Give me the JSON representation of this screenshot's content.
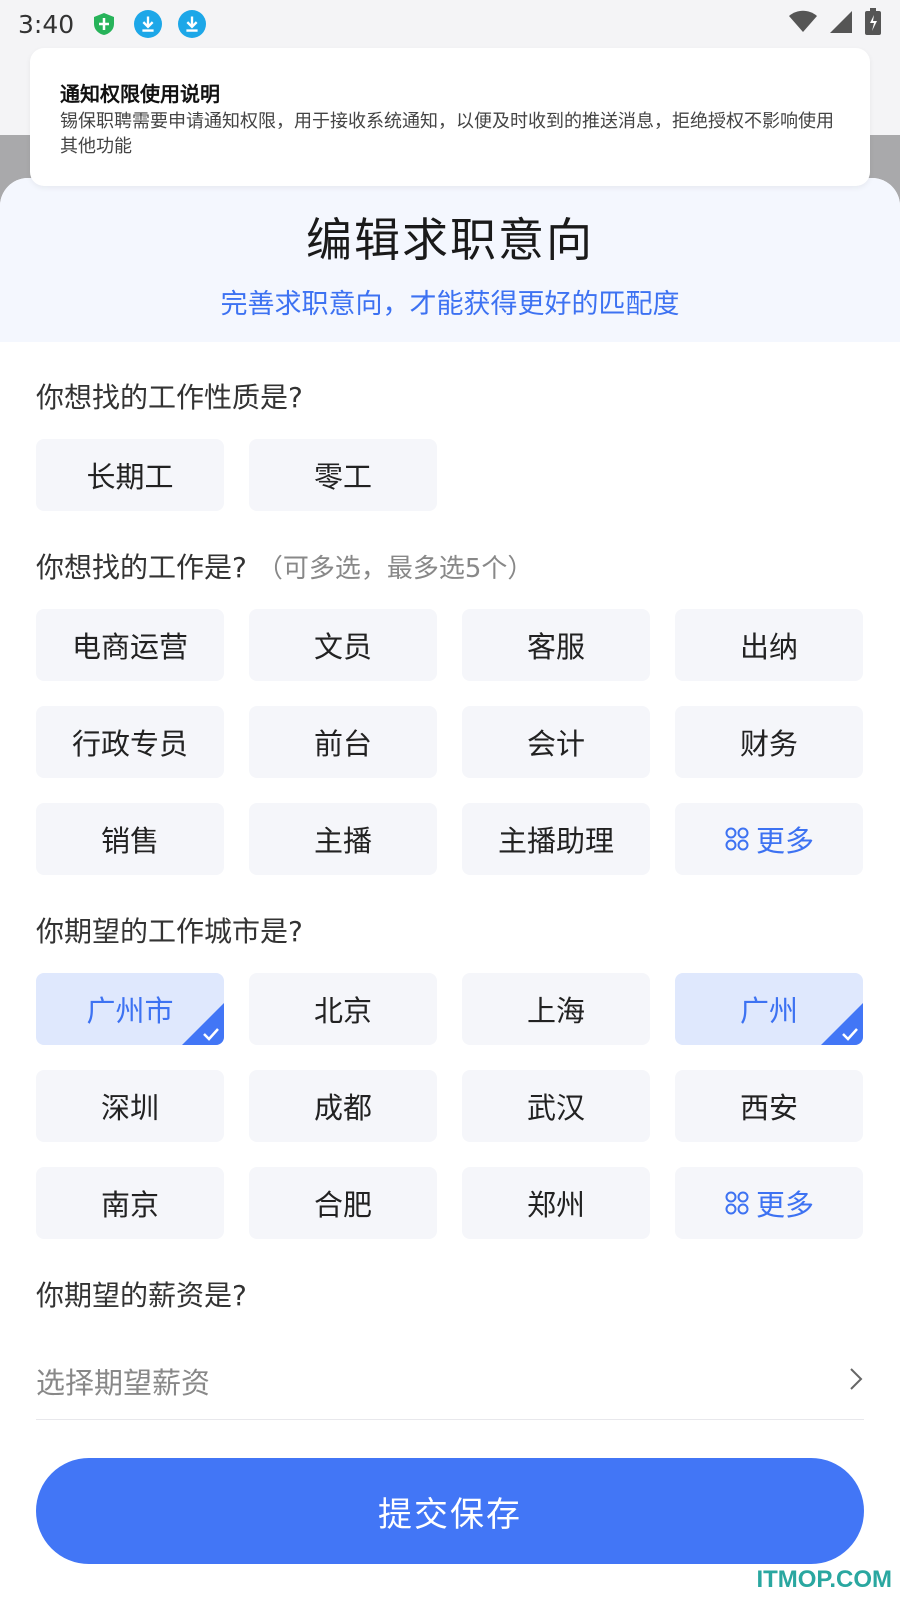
{
  "status": {
    "time": "3:40"
  },
  "notice": {
    "title": "通知权限使用说明",
    "body": "锡保职聘需要申请通知权限，用于接收系统通知，以便及时收到的推送消息，拒绝授权不影响使用其他功能"
  },
  "header": {
    "title": "编辑求职意向",
    "subtitle": "完善求职意向，才能获得更好的匹配度"
  },
  "job_type": {
    "question": "你想找的工作性质是?",
    "options": [
      "长期工",
      "零工"
    ]
  },
  "job": {
    "question": "你想找的工作是?",
    "hint": "（可多选，最多选5个）",
    "options": [
      "电商运营",
      "文员",
      "客服",
      "出纳",
      "行政专员",
      "前台",
      "会计",
      "财务",
      "销售",
      "主播",
      "主播助理"
    ],
    "more_label": "更多"
  },
  "city": {
    "question": "你期望的工作城市是?",
    "options": [
      "广州市",
      "北京",
      "上海",
      "广州",
      "深圳",
      "成都",
      "武汉",
      "西安",
      "南京",
      "合肥",
      "郑州"
    ],
    "selected": [
      "广州市",
      "广州"
    ],
    "more_label": "更多"
  },
  "salary": {
    "question": "你期望的薪资是?",
    "placeholder": "选择期望薪资"
  },
  "submit_label": "提交保存",
  "watermark": "ITMOP.COM",
  "colors": {
    "accent": "#4276f6",
    "chip_bg": "#f5f6fa",
    "selected_bg": "#dfe8fd"
  }
}
